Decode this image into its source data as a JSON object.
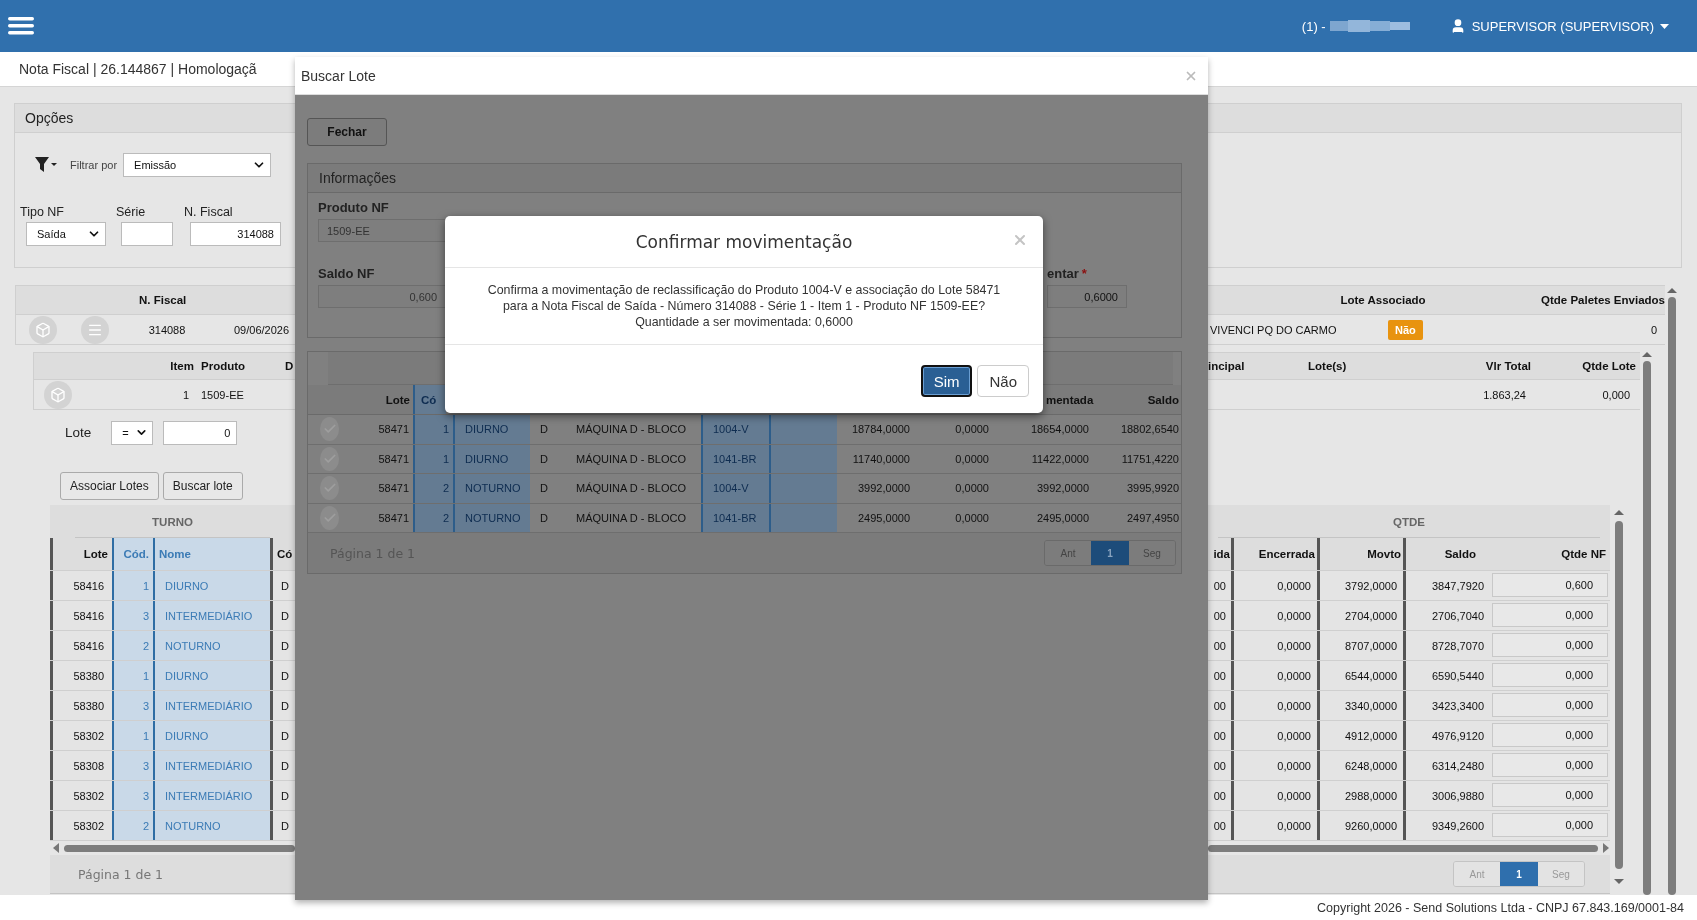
{
  "top_bar": {
    "account": "(1) -",
    "user": "SUPERVISOR (SUPERVISOR)"
  },
  "page_title": "Nota Fiscal | 26.144867 | Homologaçã",
  "options": {
    "title": "Opções",
    "filter_label": "Filtrar por",
    "filter_value": "Emissão",
    "fields": [
      {
        "label": "Tipo NF",
        "value": "Saída",
        "kind": "select"
      },
      {
        "label": "Série",
        "kind": "input"
      },
      {
        "label": "N. Fiscal",
        "value": "314088",
        "kind": "input"
      }
    ]
  },
  "nf_grid": {
    "columns": [
      "N. Fiscal",
      "Lote Associado",
      "Qtde Paletes Enviados"
    ],
    "row": {
      "nf": "314088",
      "date": "09/06/2026",
      "client": "VIVENCI PQ DO CARMO",
      "lote_associado": "Não",
      "paletes": "0"
    }
  },
  "item_grid": {
    "columns": [
      "Item",
      "Produto",
      "D",
      "incipal",
      "Lote(s)",
      "Vlr Total",
      "Qtde Lote"
    ],
    "row": {
      "item": "1",
      "produto": "1509-EE",
      "vlr_total": "1.863,24",
      "qtde_lote": "0,000"
    }
  },
  "lote_filter": {
    "label": "Lote",
    "operator": "=",
    "value": "0"
  },
  "actions": [
    "Associar Lotes",
    "Buscar lote"
  ],
  "lotes_table": {
    "groups": [
      "TURNO",
      "QTDE"
    ],
    "columns": [
      "Lote",
      "Cód.",
      "Nome",
      "Có",
      "ida",
      "Encerrada",
      "Movto",
      "Saldo",
      "Qtde NF"
    ],
    "rows": [
      {
        "lote": "58416",
        "cod": "1",
        "nome": "DIURNO",
        "col_4": "D",
        "col_5": "00",
        "encerrada": "0,0000",
        "movto": "3792,0000",
        "saldo": "3847,7920",
        "qtde_nf": "0,600"
      },
      {
        "lote": "58416",
        "cod": "3",
        "nome": "INTERMEDIÁRIO",
        "col_4": "D",
        "col_5": "00",
        "encerrada": "0,0000",
        "movto": "2704,0000",
        "saldo": "2706,7040",
        "qtde_nf": "0,000"
      },
      {
        "lote": "58416",
        "cod": "2",
        "nome": "NOTURNO",
        "col_4": "D",
        "col_5": "00",
        "encerrada": "0,0000",
        "movto": "8707,0000",
        "saldo": "8728,7070",
        "qtde_nf": "0,000"
      },
      {
        "lote": "58380",
        "cod": "1",
        "nome": "DIURNO",
        "col_4": "D",
        "col_5": "00",
        "encerrada": "0,0000",
        "movto": "6544,0000",
        "saldo": "6590,5440",
        "qtde_nf": "0,000"
      },
      {
        "lote": "58380",
        "cod": "3",
        "nome": "INTERMEDIÁRIO",
        "col_4": "D",
        "col_5": "00",
        "encerrada": "0,0000",
        "movto": "3340,0000",
        "saldo": "3423,3400",
        "qtde_nf": "0,000"
      },
      {
        "lote": "58302",
        "cod": "1",
        "nome": "DIURNO",
        "col_4": "D",
        "col_5": "00",
        "encerrada": "0,0000",
        "movto": "4912,0000",
        "saldo": "4976,9120",
        "qtde_nf": "0,000"
      },
      {
        "lote": "58308",
        "cod": "3",
        "nome": "INTERMEDIÁRIO",
        "col_4": "D",
        "col_5": "00",
        "encerrada": "0,0000",
        "movto": "6248,0000",
        "saldo": "6314,2480",
        "qtde_nf": "0,000"
      },
      {
        "lote": "58302",
        "cod": "3",
        "nome": "INTERMEDIÁRIO",
        "col_4": "D",
        "col_5": "00",
        "encerrada": "0,0000",
        "movto": "2988,0000",
        "saldo": "3006,9880",
        "qtde_nf": "0,000"
      },
      {
        "lote": "58302",
        "cod": "2",
        "nome": "NOTURNO",
        "col_4": "D",
        "col_5": "00",
        "encerrada": "0,0000",
        "movto": "9260,0000",
        "saldo": "9349,2600",
        "qtde_nf": "0,000"
      }
    ],
    "page_info": "Página 1 de 1",
    "pager": [
      {
        "label": "Ant",
        "selected": false
      },
      {
        "label": "1",
        "selected": true
      },
      {
        "label": "Seg",
        "selected": false
      }
    ]
  },
  "footer": "Copyright 2026 - Send Solutions Ltda - CNPJ 67.843.169/0001-84",
  "buscar_lote": {
    "title": "Buscar Lote",
    "close_button": "Fechar",
    "info": {
      "title": "Informações",
      "produto_label": "Produto NF",
      "produto_value": "1509-EE",
      "saldo_label": "Saldo NF",
      "saldo_value": "0,600",
      "mov_label": "entar",
      "required_mark": "*",
      "mov_value": "0,6000"
    },
    "table": {
      "columns": [
        "Lote",
        "Có",
        "mentada",
        "Saldo"
      ],
      "rows": [
        {
          "lote": "58471",
          "cod": "1",
          "nome": "DIURNO",
          "col_4": "D",
          "col_5": "MÁQUINA D - BLOCO",
          "col_6": "1004-V",
          "col_8": "18784,0000",
          "col_9": "0,0000",
          "mentada": "18654,0000",
          "saldo": "18802,6540"
        },
        {
          "lote": "58471",
          "cod": "1",
          "nome": "DIURNO",
          "col_4": "D",
          "col_5": "MÁQUINA D - BLOCO",
          "col_6": "1041-BR",
          "col_8": "11740,0000",
          "col_9": "0,0000",
          "mentada": "11422,0000",
          "saldo": "11751,4220"
        },
        {
          "lote": "58471",
          "cod": "2",
          "nome": "NOTURNO",
          "col_4": "D",
          "col_5": "MÁQUINA D - BLOCO",
          "col_6": "1004-V",
          "col_8": "3992,0000",
          "col_9": "0,0000",
          "mentada": "3992,0000",
          "saldo": "3995,9920"
        },
        {
          "lote": "58471",
          "cod": "2",
          "nome": "NOTURNO",
          "col_4": "D",
          "col_5": "MÁQUINA D - BLOCO",
          "col_6": "1041-BR",
          "col_8": "2495,0000",
          "col_9": "0,0000",
          "mentada": "2495,0000",
          "saldo": "2497,4950"
        }
      ],
      "page_info": "Página 1 de 1",
      "pager": [
        {
          "label": "Ant",
          "selected": false
        },
        {
          "label": "1",
          "selected": true
        },
        {
          "label": "Seg",
          "selected": false
        }
      ]
    }
  },
  "confirm": {
    "title": "Confirmar movimentação",
    "message": [
      "Confirma a movimentação de reclassificação do Produto 1004-V e associação do Lote 58471",
      "para a Nota Fiscal de Saída - Número 314088 - Série 1 - Item 1 - Produto NF 1509-EE?",
      "Quantidade a ser movimentada: 0,6000"
    ],
    "buttons": [
      {
        "label": "Sim",
        "selected": true
      },
      {
        "label": "Não",
        "selected": false
      }
    ]
  }
}
